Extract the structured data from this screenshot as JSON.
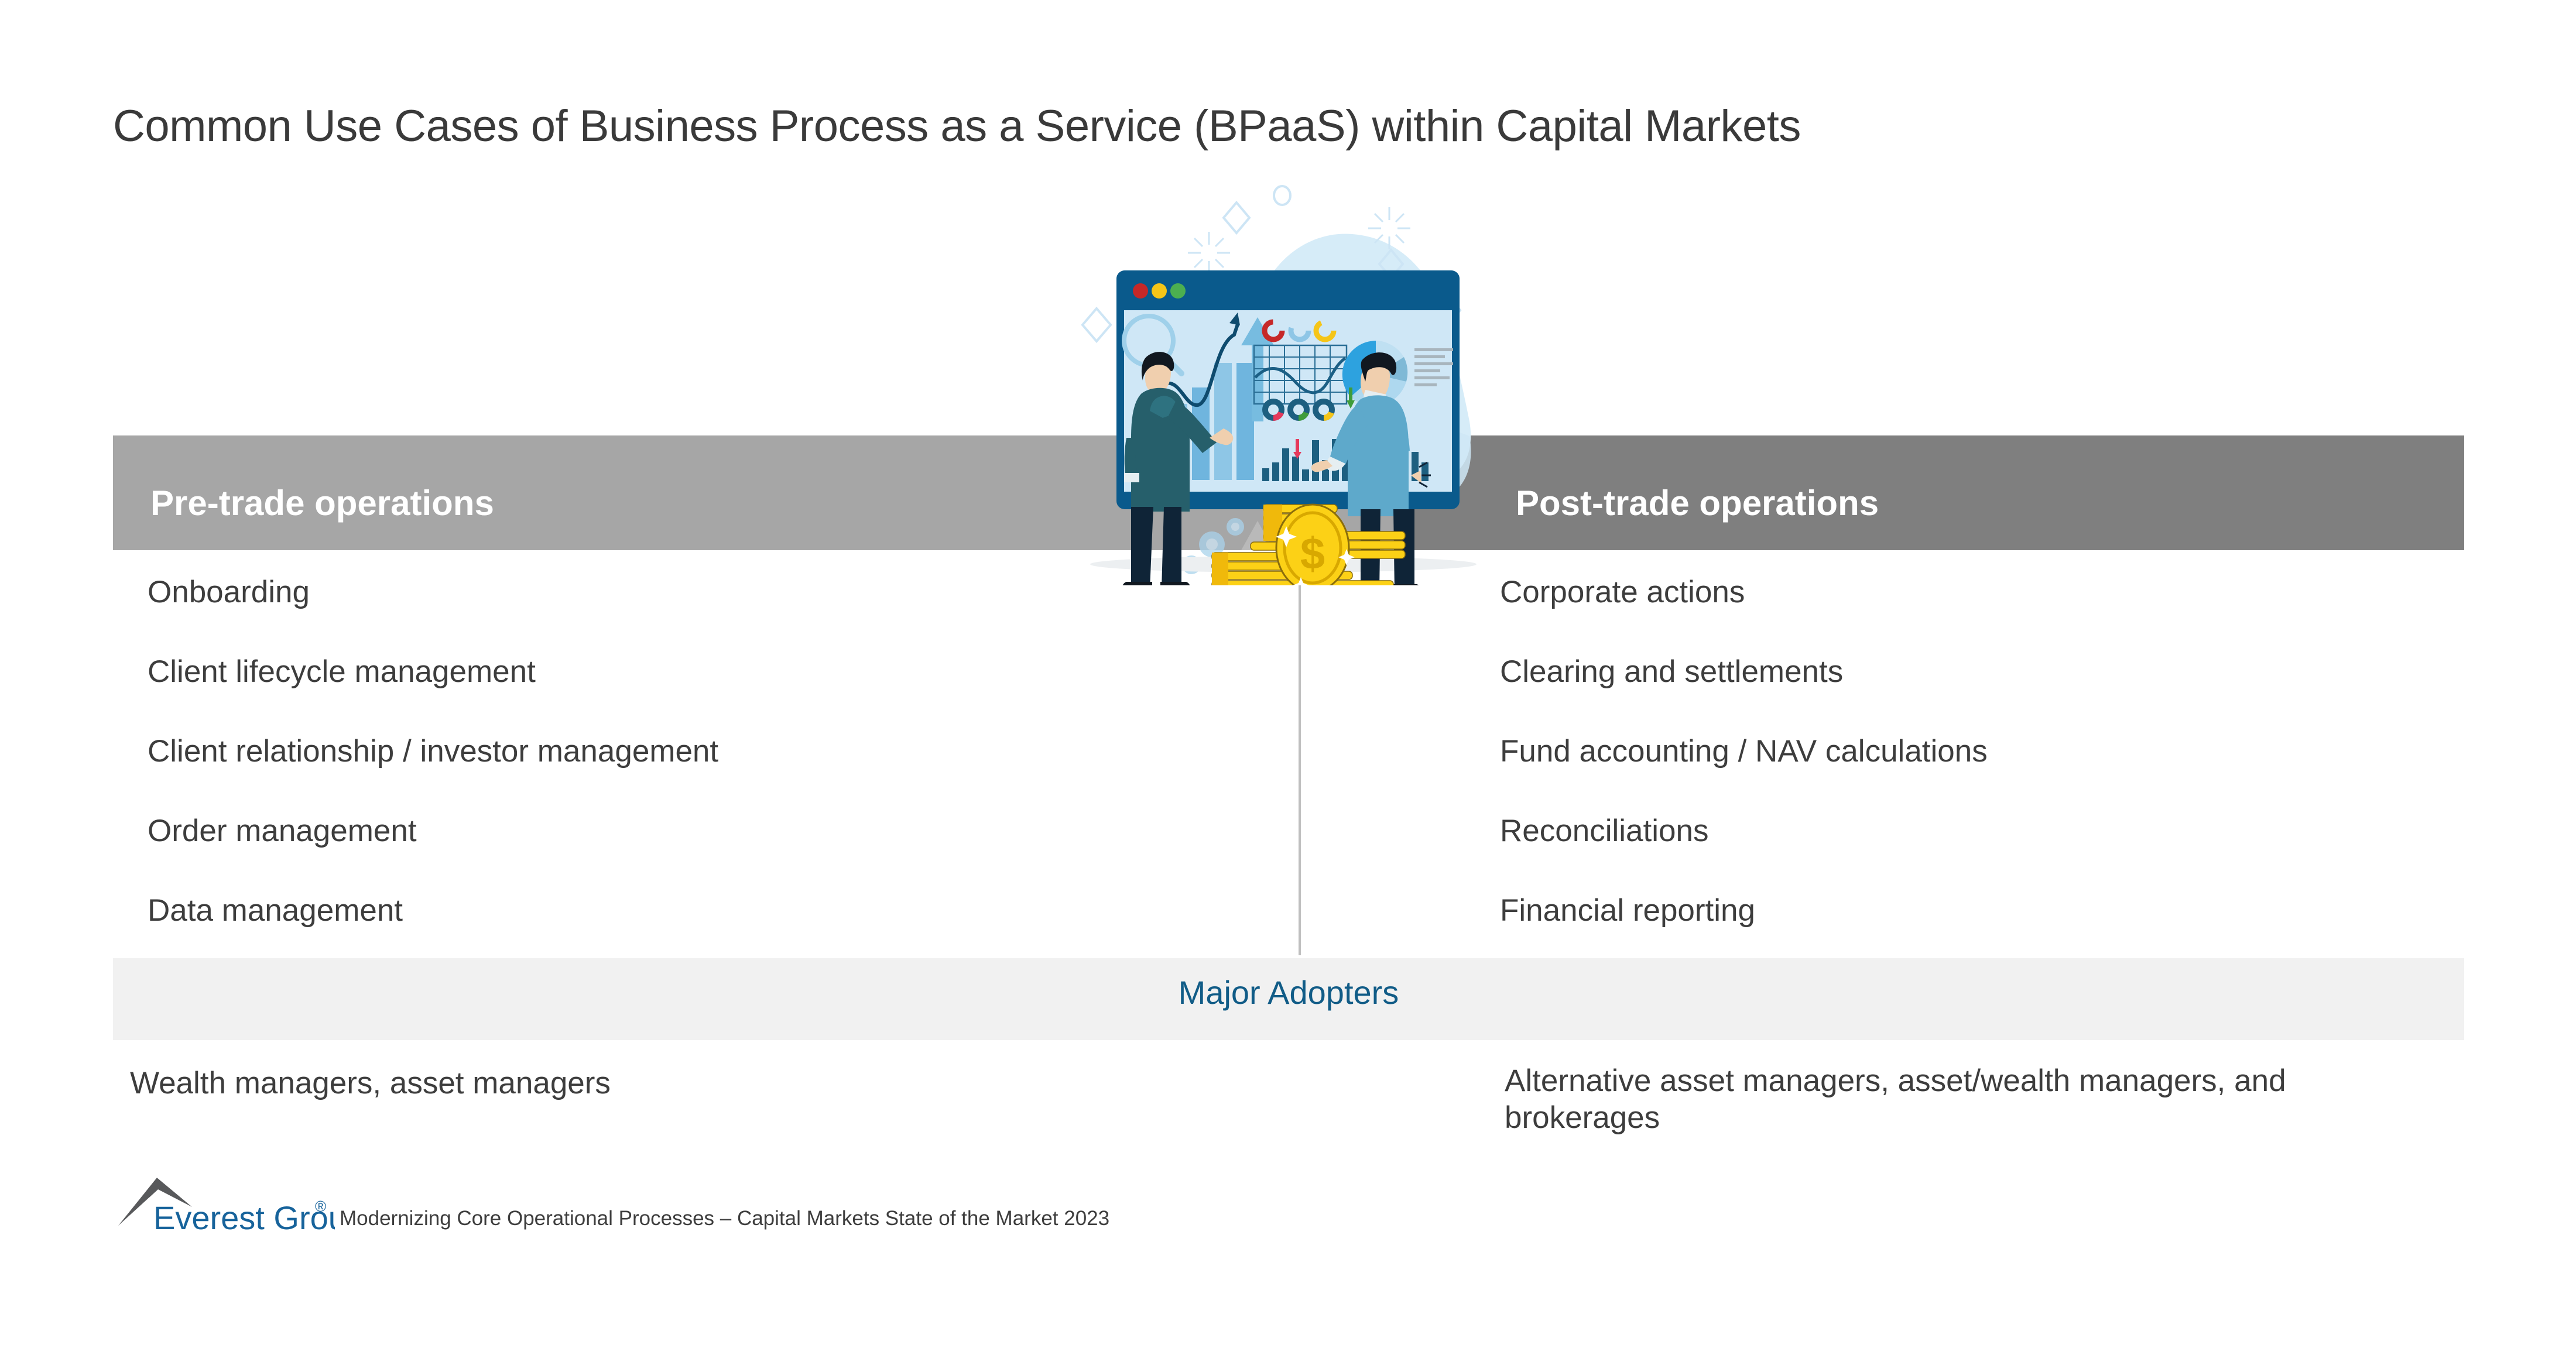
{
  "slide": {
    "title": "Common Use Cases of Business Process as a Service (BPaaS) within Capital Markets"
  },
  "columns": [
    {
      "header": "Pre-trade operations",
      "header_color": "#a6a6a6",
      "items": [
        "Onboarding",
        "Client lifecycle management",
        "Client relationship / investor management",
        "Order management",
        "Data management"
      ],
      "adopters": "Wealth managers, asset managers"
    },
    {
      "header": "Post-trade operations",
      "header_color": "#7f7f7f",
      "items": [
        "Corporate actions",
        "Clearing and settlements",
        "Fund accounting / NAV calculations",
        "Reconciliations",
        "Financial reporting"
      ],
      "adopters": "Alternative asset managers, asset/wealth managers, and brokerages"
    }
  ],
  "adopters_band": {
    "label": "Major Adopters",
    "label_color": "#115c87",
    "band_color": "#f1f1f1"
  },
  "illustration": {
    "name": "business-analytics-dashboard-illustration",
    "alt": "Two businessmen analyzing a dashboard of charts with a stack of gold coins"
  },
  "footer": {
    "brand": "Everest Group",
    "registered_mark": "®",
    "brand_color": "#17639b",
    "note": "Modernizing Core Operational Processes – Capital Markets State of the Market 2023"
  }
}
